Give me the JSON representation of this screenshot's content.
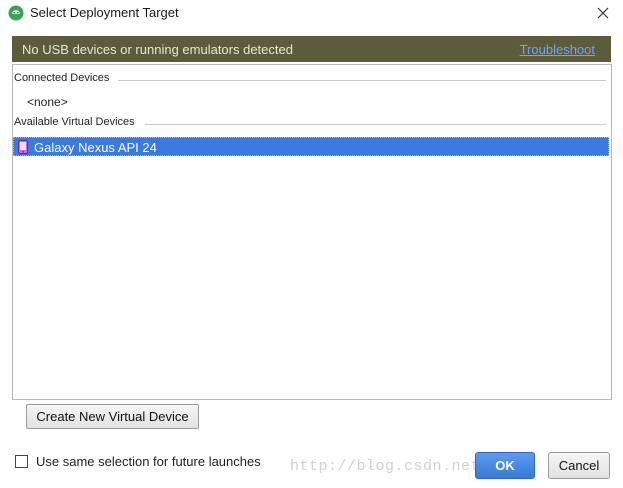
{
  "window": {
    "title": "Select Deployment Target",
    "icon": "android-studio-icon"
  },
  "banner": {
    "message": "No USB devices or running emulators detected",
    "link": "Troubleshoot",
    "bg_color": "#5c5c3c",
    "link_color": "#6aa5ff"
  },
  "connected": {
    "header": "Connected Devices",
    "items": [
      "<none>"
    ]
  },
  "available": {
    "header": "Available Virtual Devices",
    "items": [
      {
        "name": "Galaxy Nexus API 24",
        "selected": true
      }
    ]
  },
  "buttons": {
    "create": "Create New Virtual Device",
    "ok": "OK",
    "cancel": "Cancel"
  },
  "checkbox": {
    "label": "Use same selection for future launches",
    "checked": false
  },
  "watermark": "http://blog.csdn.net/...",
  "colors": {
    "selection": "#3a7ae0",
    "ok_button": "#3a7ad8"
  }
}
